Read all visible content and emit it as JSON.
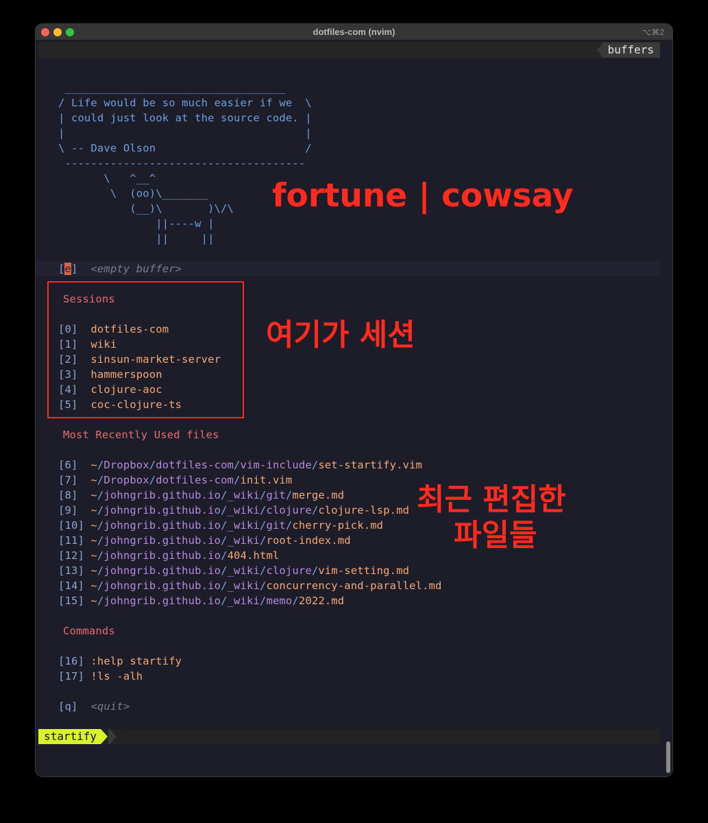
{
  "window": {
    "title": "dotfiles-com (nvim)",
    "shortcut": "⌥⌘2"
  },
  "tabline": {
    "tab_label": "buffers"
  },
  "cowsay": {
    "lines": [
      " __________________________________",
      "/ Life would be so much easier if we  \\",
      "| could just look at the source code. |",
      "|                                     |",
      "\\ -- Dave Olson                       /",
      " -------------------------------------",
      "       \\   ^__^",
      "        \\  (oo)\\_______",
      "           (__)\\       )\\/\\",
      "               ||----w |",
      "               ||     ||"
    ]
  },
  "empty_buffer": {
    "key_open": "[",
    "key": "e",
    "key_close": "]",
    "label": "<empty buffer>"
  },
  "sessions": {
    "header": "Sessions",
    "items": [
      {
        "index": "[0]",
        "name": "dotfiles-com"
      },
      {
        "index": "[1]",
        "name": "wiki"
      },
      {
        "index": "[2]",
        "name": "sinsun-market-server"
      },
      {
        "index": "[3]",
        "name": "hammerspoon"
      },
      {
        "index": "[4]",
        "name": "clojure-aoc"
      },
      {
        "index": "[5]",
        "name": "coc-clojure-ts"
      }
    ]
  },
  "mru": {
    "header": "Most Recently Used files",
    "items": [
      {
        "index": "[6]",
        "dirs": [
          "~",
          "Dropbox",
          "dotfiles-com",
          "vim-include"
        ],
        "file": "set-startify.vim"
      },
      {
        "index": "[7]",
        "dirs": [
          "~",
          "Dropbox",
          "dotfiles-com"
        ],
        "file": "init.vim"
      },
      {
        "index": "[8]",
        "dirs": [
          "~",
          "johngrib.github.io",
          "_wiki",
          "git"
        ],
        "file": "merge.md"
      },
      {
        "index": "[9]",
        "dirs": [
          "~",
          "johngrib.github.io",
          "_wiki",
          "clojure"
        ],
        "file": "clojure-lsp.md"
      },
      {
        "index": "[10]",
        "dirs": [
          "~",
          "johngrib.github.io",
          "_wiki",
          "git"
        ],
        "file": "cherry-pick.md"
      },
      {
        "index": "[11]",
        "dirs": [
          "~",
          "johngrib.github.io",
          "_wiki"
        ],
        "file": "root-index.md"
      },
      {
        "index": "[12]",
        "dirs": [
          "~",
          "johngrib.github.io"
        ],
        "file": "404.html"
      },
      {
        "index": "[13]",
        "dirs": [
          "~",
          "johngrib.github.io",
          "_wiki",
          "clojure"
        ],
        "file": "vim-setting.md"
      },
      {
        "index": "[14]",
        "dirs": [
          "~",
          "johngrib.github.io",
          "_wiki"
        ],
        "file": "concurrency-and-parallel.md"
      },
      {
        "index": "[15]",
        "dirs": [
          "~",
          "johngrib.github.io",
          "_wiki",
          "memo"
        ],
        "file": "2022.md"
      }
    ]
  },
  "commands": {
    "header": "Commands",
    "items": [
      {
        "index": "[16]",
        "cmd": ":help startify"
      },
      {
        "index": "[17]",
        "cmd": "!ls -alh"
      }
    ]
  },
  "quit": {
    "index": "[q]",
    "label": "<quit>"
  },
  "statusline": {
    "mode": "startify"
  },
  "annotations": {
    "cowsay": "fortune | cowsay",
    "session": "여기가 세션",
    "recent_line1": "최근 편집한",
    "recent_line2": "파일들"
  },
  "colors": {
    "background": "#1d1d2a",
    "section": "#e46d6d",
    "file": "#f5a978",
    "dir": "#b68ae0",
    "cow": "#6c9fe0",
    "annotation": "#ff2b1f",
    "mode": "#d8f22c"
  }
}
